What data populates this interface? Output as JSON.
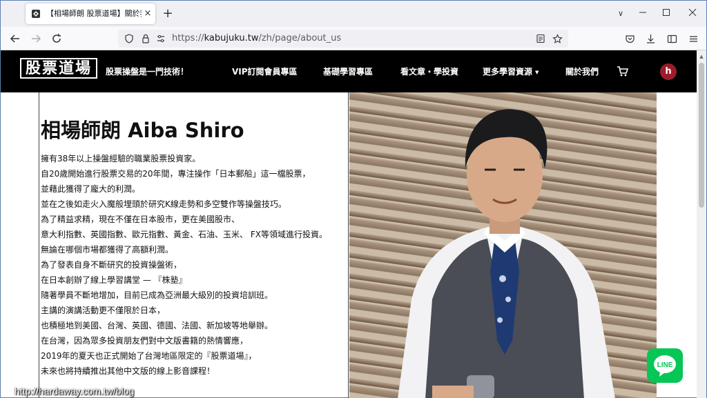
{
  "browser": {
    "tab_title": "【相場師朗 股票道場】關於我們",
    "tab_close": "×",
    "new_tab": "+",
    "tab_list": "∨",
    "url_prefix": "https://",
    "url_host": "kabujuku.tw",
    "url_path": "/zh/page/about_us"
  },
  "site": {
    "logo_text": "股票道場",
    "slogan": "股票操盤是一門技術！",
    "nav": [
      {
        "label": "VIP訂閱會員專區"
      },
      {
        "label": "基礎學習專區"
      },
      {
        "label": "看文章・學投資"
      },
      {
        "label": "更多學習資源"
      },
      {
        "label": "關於我們"
      }
    ],
    "avatar_initial": "h"
  },
  "content": {
    "title": "相場師朗 Aiba Shiro",
    "bio_lines": [
      "擁有38年以上操盤經驗的職業股票投資家。",
      "自20歲開始進行股票交易的20年間，專注操作「日本郵船」這一檔股票，",
      "並藉此獲得了龐大的利潤。",
      "並在之後如走火入魔般埋頭於研究K線走勢和多空雙作等操盤技巧。",
      "為了精益求精，現在不僅在日本股市，更在美國股市、",
      "意大利指數、英國指數、歐元指數、黃金、石油、玉米、 FX等領域進行投資。",
      "無論在哪個市場都獲得了高額利潤。",
      "為了發表自身不斷研究的投資操盤術，",
      "在日本創辦了線上學習講堂 — 『株塾』",
      "隨著學員不斷地增加，目前已成為亞洲最大級別的投資培訓班。",
      "主講的演講活動更不僅限於日本，",
      "也積極地到美國、台灣、英國、德國、法國、新加坡等地舉辦。",
      "在台灣，因為眾多投資朋友們對中文版書籍的熱情響應，",
      "2019年的夏天也正式開始了台灣地區限定的『股票道場』，",
      "未來也將持續推出其他中文版的線上影音課程！"
    ]
  },
  "line_button": "LINE",
  "watermark": "http://hardaway.com.tw/blog",
  "colors": {
    "header_bg": "#000000",
    "avatar_bg": "#9b1c2c",
    "line_green": "#06c755"
  }
}
